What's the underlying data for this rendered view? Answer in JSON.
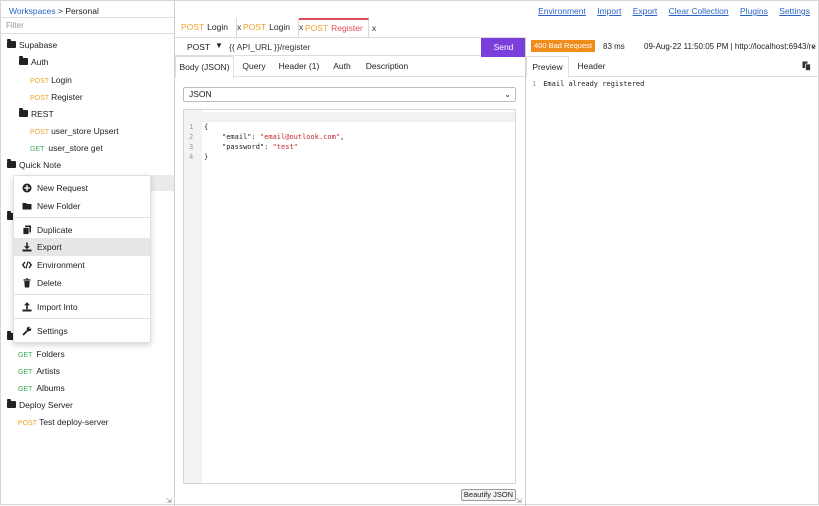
{
  "breadcrumb": {
    "workspaces": "Workspaces",
    "separator": ">",
    "current": "Personal"
  },
  "filter": {
    "placeholder": "Filter",
    "value": ""
  },
  "nav": [
    "Environment",
    "Import",
    "Export",
    "Clear Collection",
    "Plugins",
    "Settings"
  ],
  "tree": {
    "supabase": "Supabase",
    "auth": "Auth",
    "auth_login": {
      "method": "POST",
      "name": "Login"
    },
    "auth_register": {
      "method": "POST",
      "name": "Register"
    },
    "rest": "REST",
    "rest_upsert": {
      "method": "POST",
      "name": "user_store Upsert"
    },
    "rest_get": {
      "method": "GET",
      "name": "user_store get"
    },
    "quick_note": "Quick Note",
    "folders": {
      "method": "GET",
      "name": "Folders"
    },
    "artists": {
      "method": "GET",
      "name": "Artists"
    },
    "albums": {
      "method": "GET",
      "name": "Albums"
    },
    "deploy_server": "Deploy Server",
    "test_deploy": {
      "method": "POST",
      "name": "Test deploy-server"
    }
  },
  "context_menu": {
    "new_request": "New Request",
    "new_folder": "New Folder",
    "duplicate": "Duplicate",
    "export": "Export",
    "environment": "Environment",
    "delete": "Delete",
    "import_into": "Import Into",
    "settings": "Settings"
  },
  "tabs": [
    {
      "method": "POST",
      "name": "Login",
      "close": "x"
    },
    {
      "method": "POST",
      "name": "Login",
      "close": "x"
    },
    {
      "method": "POST",
      "name": "Register",
      "close": "x"
    }
  ],
  "request": {
    "method": "POST",
    "url": "{{ API_URL }}/register",
    "send_label": "Send",
    "subtabs": [
      "Body (JSON)",
      "Query",
      "Header (1)",
      "Auth",
      "Description"
    ],
    "body_type": "JSON",
    "code": {
      "l1": "1",
      "l2": "2",
      "l3": "3",
      "l4": "4",
      "open": "{",
      "email_key": "\"email\"",
      "email_val": "\"email@outlook.com\"",
      "password_key": "\"password\"",
      "password_val": "\"test\"",
      "close": "}"
    },
    "beautify_label": "Beautify JSON"
  },
  "response": {
    "status": "400 Bad Request",
    "time": "83 ms",
    "info": "09-Aug-22 11:50:05 PM | http://localhost:6943/re",
    "tabs": [
      "Preview",
      "Header"
    ],
    "line_no": "1",
    "body": "Email already registered"
  },
  "colors": {
    "accent": "#7c3edb",
    "post": "#f0a22b",
    "get": "#3aa757",
    "status_error": "#f08c1a",
    "active_tab": "#e04b5a",
    "link": "#2a64c5"
  }
}
